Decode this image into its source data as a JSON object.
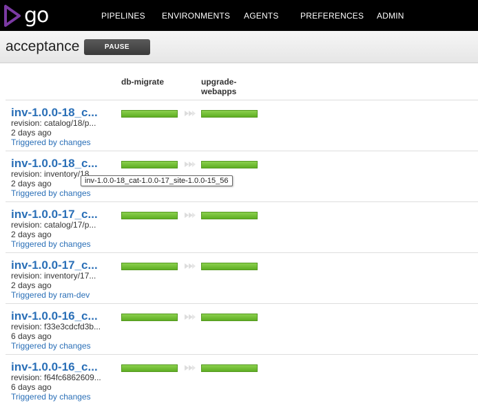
{
  "brand": {
    "logo_text": "go"
  },
  "nav": {
    "items": [
      "PIPELINES",
      "ENVIRONMENTS",
      "AGENTS",
      "PREFERENCES",
      "ADMIN"
    ]
  },
  "pipeline": {
    "name": "acceptance",
    "pause_label": "PAUSE"
  },
  "stages": {
    "headers": [
      "db-migrate",
      "upgrade-\nwebapps"
    ],
    "status": "passed",
    "status_color": "#6bbf2f"
  },
  "runs": [
    {
      "label": "inv-1.0.0-18_c...",
      "revision": "revision: catalog/18/p...",
      "age": "2 days ago",
      "trigger": "Triggered by changes"
    },
    {
      "label": "inv-1.0.0-18_c...",
      "revision": "revision: inventory/18...",
      "age": "2 days ago",
      "trigger": "Triggered by changes"
    },
    {
      "label": "inv-1.0.0-17_c...",
      "revision": "revision: catalog/17/p...",
      "age": "2 days ago",
      "trigger": "Triggered by changes"
    },
    {
      "label": "inv-1.0.0-17_c...",
      "revision": "revision: inventory/17...",
      "age": "2 days ago",
      "trigger": "Triggered by ram-dev"
    },
    {
      "label": "inv-1.0.0-16_c...",
      "revision": "revision: f33e3cdcfd3b...",
      "age": "6 days ago",
      "trigger": "Triggered by changes"
    },
    {
      "label": "inv-1.0.0-16_c...",
      "revision": "revision: f64fc6862609...",
      "age": "6 days ago",
      "trigger": "Triggered by changes"
    }
  ],
  "tooltip": {
    "text": "inv-1.0.0-18_cat-1.0.0-17_site-1.0.0-15_56"
  },
  "colors": {
    "link": "#2a6fb7",
    "nav_bg": "#000000",
    "logo_accent": "#7b3aa3"
  }
}
